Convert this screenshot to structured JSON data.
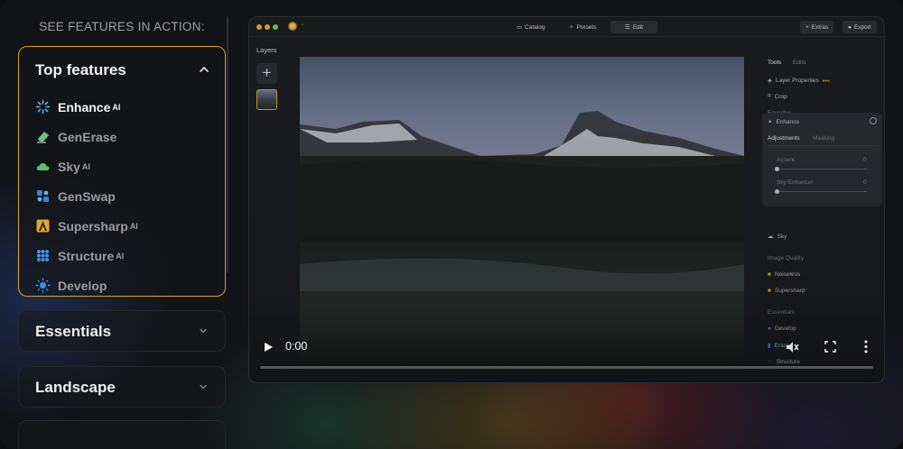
{
  "left": {
    "heading": "SEE FEATURES IN ACTION:",
    "top_features": {
      "title": "Top features",
      "items": [
        {
          "label": "Enhance",
          "ai": "AI",
          "icon": "enhance-sparkle-icon"
        },
        {
          "label": "GenErase",
          "ai": "",
          "icon": "eraser-icon"
        },
        {
          "label": "Sky",
          "ai": "AI",
          "icon": "cloud-icon"
        },
        {
          "label": "GenSwap",
          "ai": "",
          "icon": "genswap-icon"
        },
        {
          "label": "Supersharp",
          "ai": "AI",
          "icon": "supersharp-icon"
        },
        {
          "label": "Structure",
          "ai": "AI",
          "icon": "structure-dots-icon"
        },
        {
          "label": "Develop",
          "ai": "",
          "icon": "develop-sun-icon"
        }
      ]
    },
    "sections": [
      {
        "label": "Essentials"
      },
      {
        "label": "Landscape"
      }
    ]
  },
  "app": {
    "topbar": {
      "catalog": "Catalog",
      "presets": "Presets",
      "edit": "Edit",
      "extras": "Extras",
      "export": "Export"
    },
    "layers_title": "Layers",
    "panel": {
      "tab_tools": "Tools",
      "tab_edits": "Edits",
      "layer_properties": "Layer Properties",
      "crop": "Crop",
      "favorites": "Favorites",
      "enhance": "Enhance",
      "tab_adjustments": "Adjustments",
      "tab_masking": "Masking",
      "accent_label": "Accent",
      "accent_value": "0",
      "sky_enhancer_label": "Sky Enhancer",
      "sky_enhancer_value": "0",
      "sky": "Sky",
      "image_quality": "Image Quality",
      "noiseless": "Noiseless",
      "supersharp": "Supersharp",
      "essentials": "Essentials",
      "develop": "Develop",
      "erase": "Erase",
      "structure": "Structure"
    }
  },
  "video": {
    "time": "0:00",
    "progress": 0
  },
  "colors": {
    "accent": "#d4a52b",
    "background": "#121316"
  }
}
